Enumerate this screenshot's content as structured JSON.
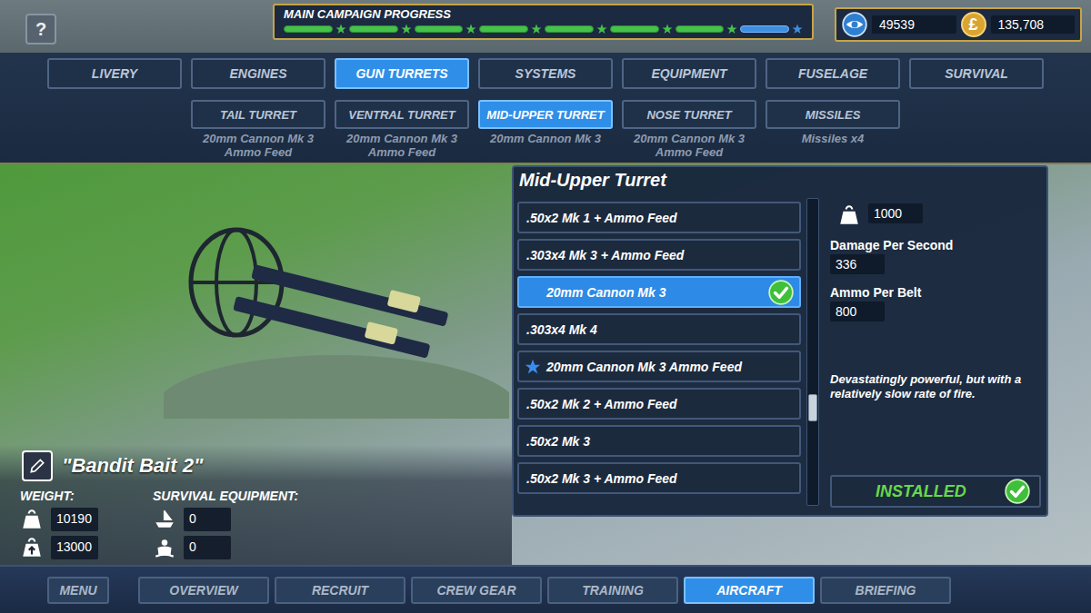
{
  "hud": {
    "help": "?",
    "campaign_title": "MAIN CAMPAIGN PROGRESS",
    "campaign_segments": [
      {
        "complete": true
      },
      {
        "complete": true
      },
      {
        "complete": true
      },
      {
        "complete": true
      },
      {
        "complete": true
      },
      {
        "complete": true
      },
      {
        "complete": true
      },
      {
        "complete": false
      }
    ],
    "intel": "49539",
    "coin_symbol": "£",
    "money": "135,708"
  },
  "tabs": [
    {
      "label": "LIVERY",
      "selected": false
    },
    {
      "label": "ENGINES",
      "selected": false
    },
    {
      "label": "GUN TURRETS",
      "selected": true
    },
    {
      "label": "SYSTEMS",
      "selected": false
    },
    {
      "label": "EQUIPMENT",
      "selected": false
    },
    {
      "label": "FUSELAGE",
      "selected": false
    },
    {
      "label": "SURVIVAL",
      "selected": false
    }
  ],
  "subtabs": [
    {
      "label": "TAIL TURRET",
      "caption": [
        "20mm Cannon Mk 3",
        "Ammo Feed"
      ],
      "selected": false
    },
    {
      "label": "VENTRAL TURRET",
      "caption": [
        "20mm Cannon Mk 3",
        "Ammo Feed"
      ],
      "selected": false
    },
    {
      "label": "MID-UPPER TURRET",
      "caption": [
        "20mm Cannon Mk 3"
      ],
      "selected": true
    },
    {
      "label": "NOSE TURRET",
      "caption": [
        "20mm Cannon Mk 3",
        "Ammo Feed"
      ],
      "selected": false
    },
    {
      "label": "MISSILES",
      "caption": [
        "Missiles x4"
      ],
      "selected": false
    }
  ],
  "panel": {
    "title": "Mid-Upper Turret",
    "items": [
      {
        "label": ".50x2 Mk 1 + Ammo Feed",
        "selected": false,
        "equipped": false,
        "new": false
      },
      {
        "label": ".303x4 Mk 3 + Ammo Feed",
        "selected": false,
        "equipped": false,
        "new": false
      },
      {
        "label": "20mm Cannon Mk 3",
        "selected": true,
        "equipped": true,
        "new": false
      },
      {
        "label": ".303x4 Mk 4",
        "selected": false,
        "equipped": false,
        "new": false
      },
      {
        "label": "20mm Cannon Mk 3 Ammo Feed",
        "selected": false,
        "equipped": false,
        "new": true
      },
      {
        "label": ".50x2 Mk 2 + Ammo Feed",
        "selected": false,
        "equipped": false,
        "new": false
      },
      {
        "label": ".50x2 Mk 3",
        "selected": false,
        "equipped": false,
        "new": false
      },
      {
        "label": ".50x2 Mk 3 + Ammo Feed",
        "selected": false,
        "equipped": false,
        "new": false
      }
    ],
    "scroll": {
      "level": 0.7
    },
    "weight": "1000",
    "stats": [
      {
        "label": "Damage Per Second",
        "value": "336"
      },
      {
        "label": "Ammo Per Belt",
        "value": "800"
      }
    ],
    "description": "Devastatingly powerful, but with a relatively slow rate of fire.",
    "status": "INSTALLED",
    "installed": true
  },
  "aircraft": {
    "name": "\"Bandit Bait 2\"",
    "weight_label": "WEIGHT:",
    "weight": "10190",
    "max_weight": "13000",
    "survival_label": "SURVIVAL EQUIPMENT:",
    "dinghies": "0",
    "life_vests": "0"
  },
  "nav": [
    {
      "label": "MENU",
      "kind": "menu",
      "selected": false
    },
    {
      "label": "OVERVIEW",
      "kind": "tab",
      "selected": false
    },
    {
      "label": "RECRUIT",
      "kind": "tab",
      "selected": false
    },
    {
      "label": "CREW GEAR",
      "kind": "tab",
      "selected": false
    },
    {
      "label": "TRAINING",
      "kind": "tab",
      "selected": false
    },
    {
      "label": "AIRCRAFT",
      "kind": "tab",
      "selected": true
    },
    {
      "label": "BRIEFING",
      "kind": "tab",
      "selected": false
    }
  ]
}
